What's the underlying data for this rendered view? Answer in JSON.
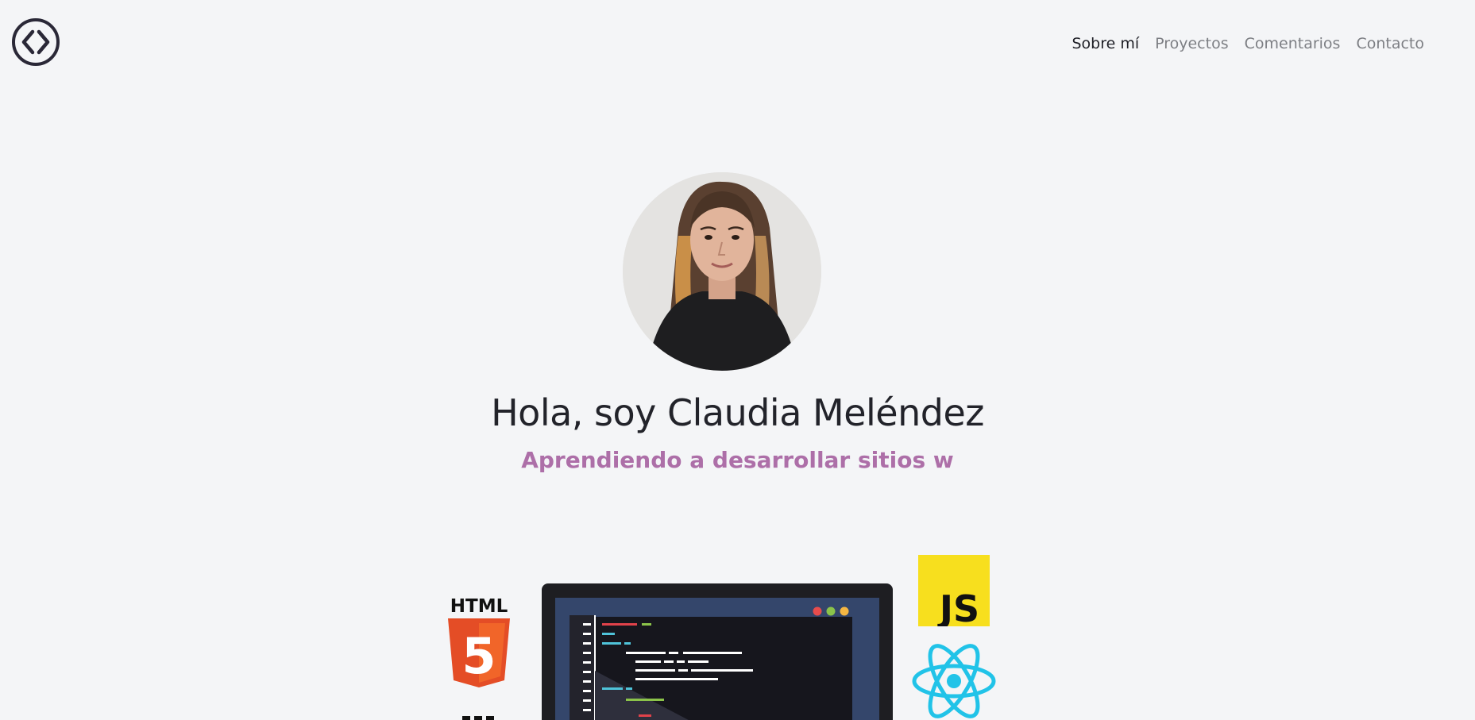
{
  "nav": {
    "items": [
      {
        "label": "Sobre mí",
        "active": true
      },
      {
        "label": "Proyectos",
        "active": false
      },
      {
        "label": "Comentarios",
        "active": false
      },
      {
        "label": "Contacto",
        "active": false
      }
    ]
  },
  "hero": {
    "title": "Hola, soy Claudia Meléndez",
    "subtitle": "Aprendiendo a desarrollar sitios w"
  },
  "tech_logos": {
    "html5": {
      "text": "HTML",
      "digit": "5",
      "color": "#e44d26"
    },
    "javascript": {
      "text": "JS",
      "color": "#f7df1e"
    },
    "react": {
      "color": "#21c3e8"
    }
  },
  "colors": {
    "background": "#f4f5f7",
    "heading": "#22232a",
    "accent": "#ad6fa8",
    "nav_inactive": "#7d7f84",
    "nav_active": "#1e1f26"
  },
  "icons": {
    "logo": "code-brackets-logo-icon",
    "avatar": "profile-photo",
    "laptop": "laptop-code-illustration"
  }
}
